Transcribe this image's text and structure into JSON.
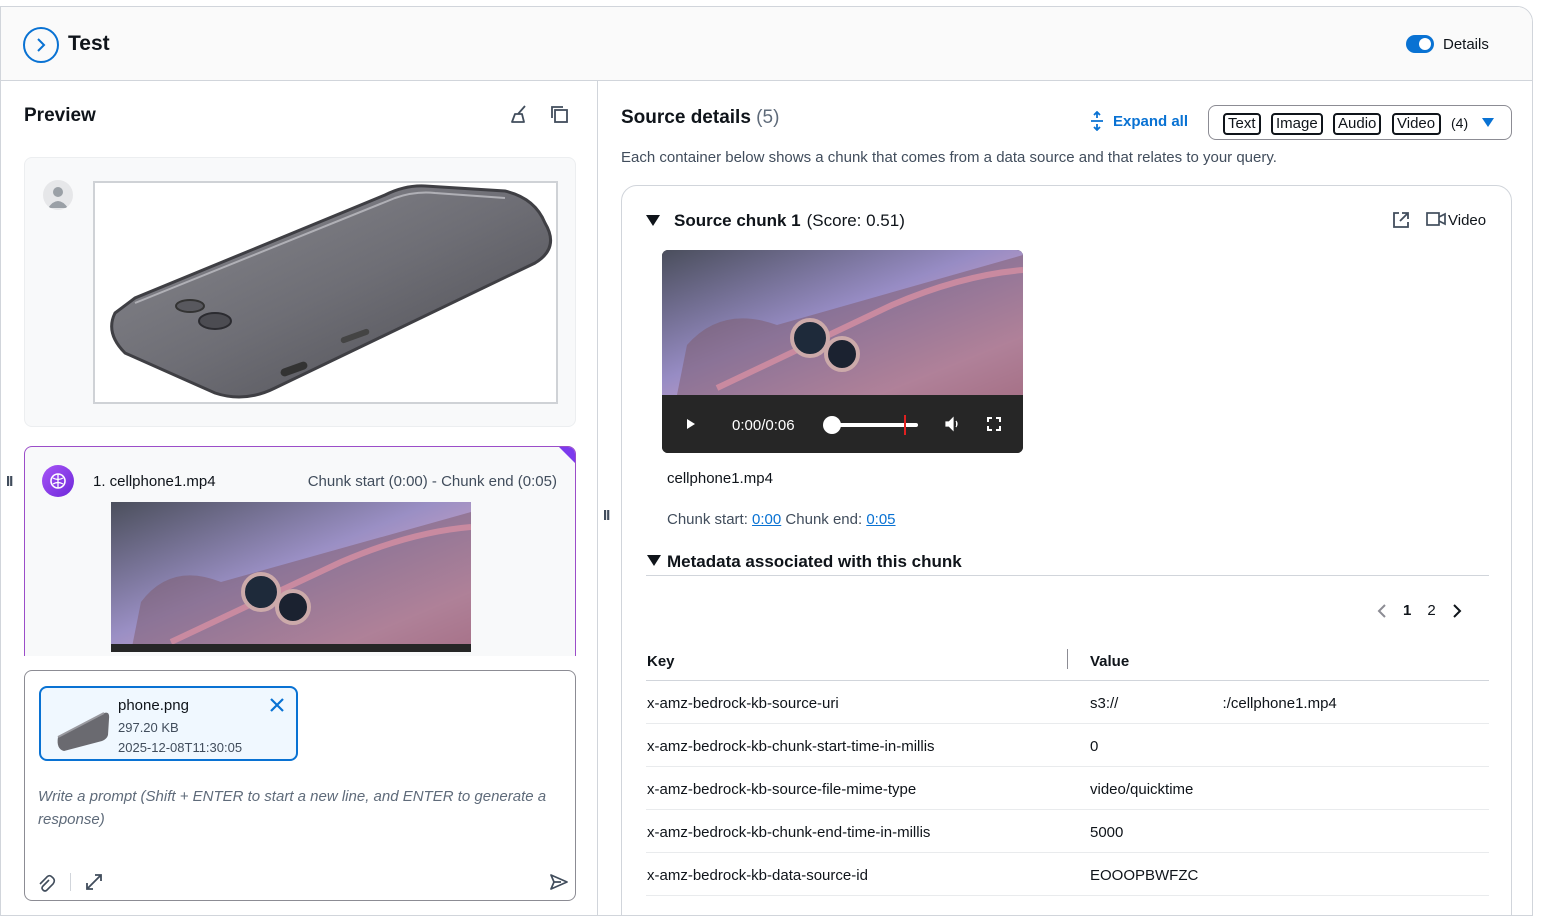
{
  "header": {
    "title": "Test",
    "details_label": "Details"
  },
  "preview": {
    "title": "Preview",
    "response": {
      "file": "1. cellphone1.mp4",
      "chunk_range": "Chunk start (0:00) - Chunk end (0:05)"
    },
    "attachment": {
      "name": "phone.png",
      "size": "297.20 KB",
      "date": "2025-12-08T11:30:05"
    },
    "prompt_placeholder": "Write a prompt (Shift + ENTER to start a new line, and ENTER to generate a response)"
  },
  "source": {
    "title": "Source details",
    "count": "(5)",
    "expand_all": "Expand all",
    "filters": [
      "Text",
      "Image",
      "Audio",
      "Video"
    ],
    "filter_count": "(4)",
    "description": "Each container below shows a chunk that comes from a data source and that relates to your query.",
    "chunk": {
      "title": "Source chunk 1",
      "score": "(Score: 0.51)",
      "type_label": "Video",
      "video_time": "0:00/0:06",
      "video_progress": 0.85,
      "file": "cellphone1.mp4",
      "start_label": "Chunk start:",
      "start_value": "0:00",
      "end_label": "Chunk end:",
      "end_value": "0:05"
    },
    "metadata": {
      "title": "Metadata associated with this chunk",
      "pages": [
        "1",
        "2"
      ],
      "current_page": "1",
      "key_header": "Key",
      "value_header": "Value",
      "rows": [
        {
          "key": "x-amz-bedrock-kb-source-uri",
          "value": "s3://                         :/cellphone1.mp4"
        },
        {
          "key": "x-amz-bedrock-kb-chunk-start-time-in-millis",
          "value": "0"
        },
        {
          "key": "x-amz-bedrock-kb-source-file-mime-type",
          "value": "video/quicktime"
        },
        {
          "key": "x-amz-bedrock-kb-chunk-end-time-in-millis",
          "value": "5000"
        },
        {
          "key": "x-amz-bedrock-kb-data-source-id",
          "value": "EOOOPBWFZC"
        }
      ]
    }
  },
  "colors": {
    "accent": "#0972d3",
    "response_border": "#9b4dc9",
    "timeline_marker": "#e02020"
  },
  "icons": [
    "chevron-right-icon",
    "broom-icon",
    "copy-icon",
    "user-icon",
    "brain-icon",
    "close-icon",
    "paperclip-icon",
    "expand-icon",
    "send-icon",
    "expand-all-icon",
    "caret-down-icon",
    "external-link-icon",
    "video-icon",
    "play-icon",
    "volume-icon",
    "fullscreen-icon",
    "chevron-left-icon"
  ]
}
